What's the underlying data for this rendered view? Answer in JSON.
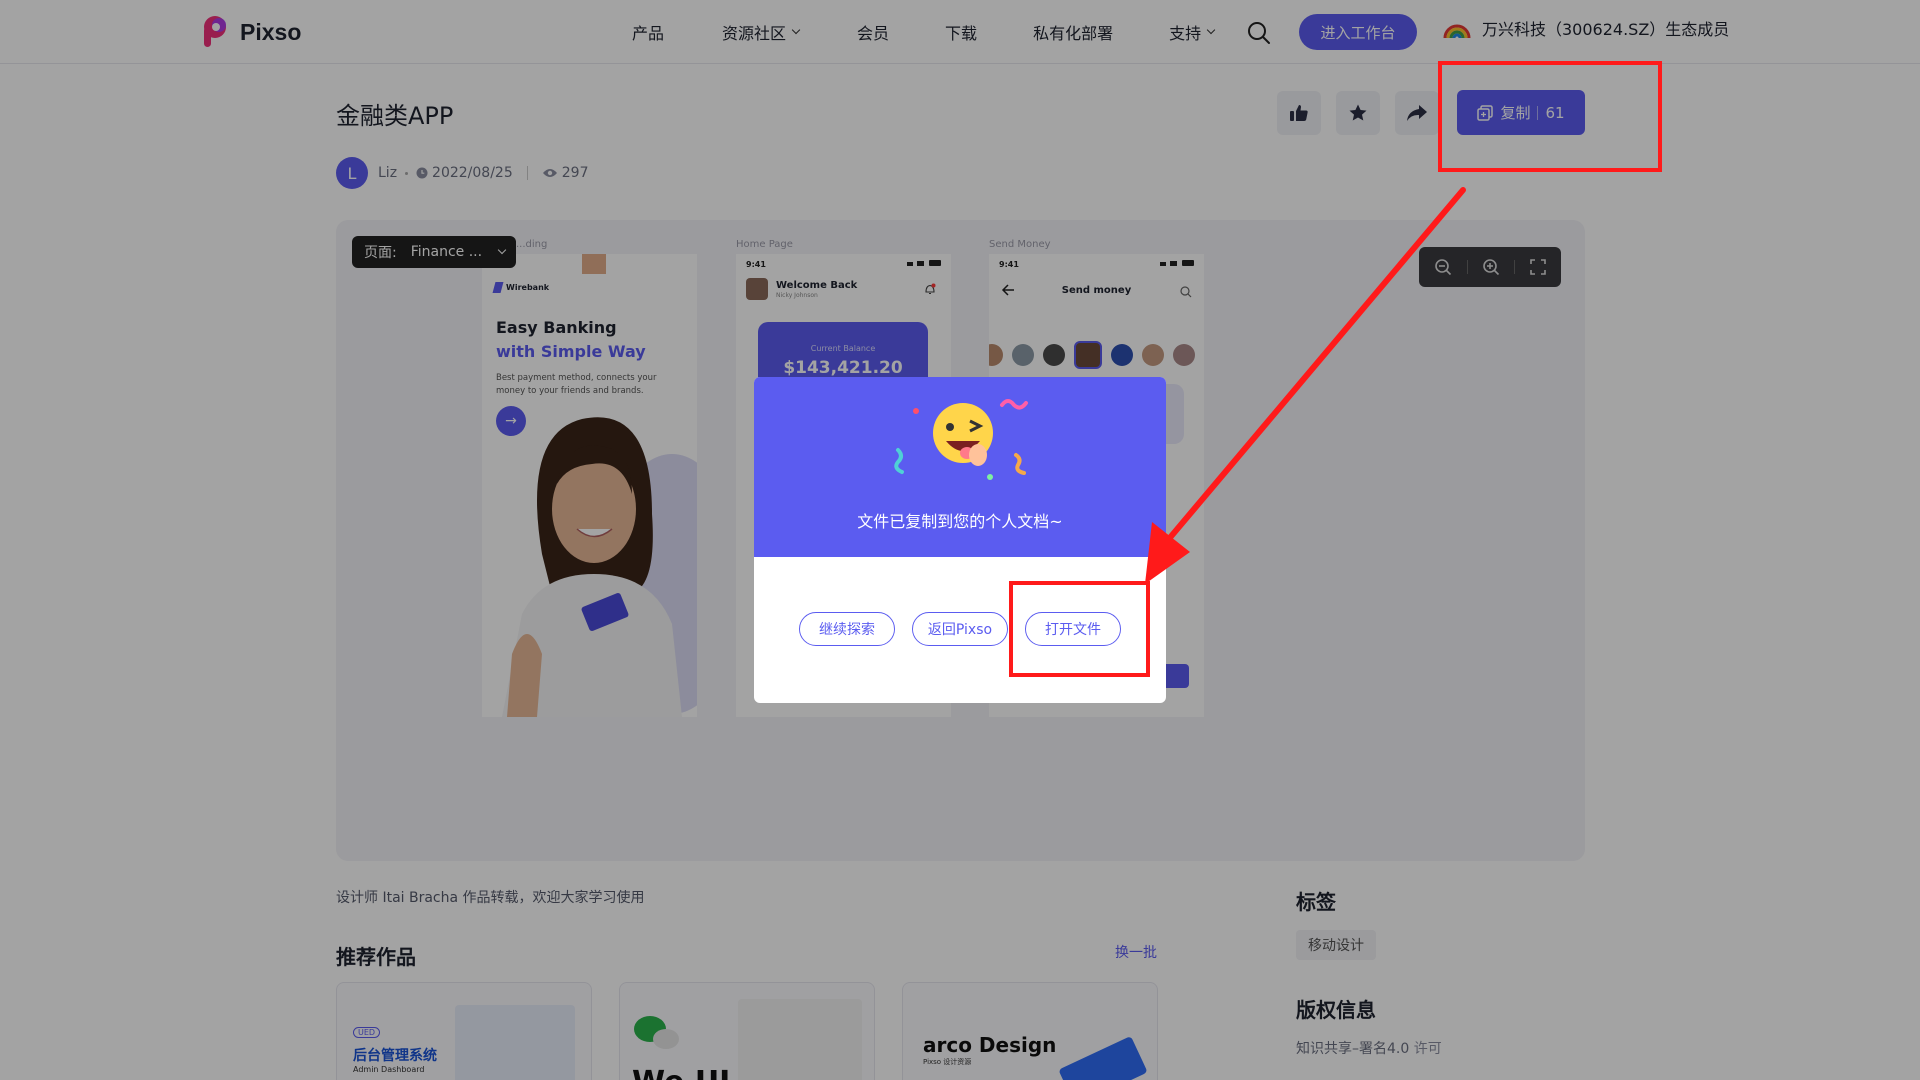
{
  "header": {
    "brand": "Pixso",
    "nav": [
      {
        "label": "产品",
        "has_dropdown": false
      },
      {
        "label": "资源社区",
        "has_dropdown": true
      },
      {
        "label": "会员",
        "has_dropdown": false
      },
      {
        "label": "下载",
        "has_dropdown": false
      },
      {
        "label": "私有化部署",
        "has_dropdown": false
      },
      {
        "label": "支持",
        "has_dropdown": true
      }
    ],
    "workspace_button": "进入工作台",
    "eco_member": "万兴科技（300624.SZ）生态成员"
  },
  "work": {
    "title": "金融类APP",
    "author_initial": "L",
    "author": "Liz",
    "date": "2022/08/25",
    "views": "297",
    "copy_label": "复制",
    "copy_count": "61"
  },
  "preview": {
    "page_select_prefix": "页面:",
    "page_select_value": "Finance ...",
    "frames": [
      {
        "label": "...ding"
      },
      {
        "label": "Home Page"
      },
      {
        "label": "Send Money"
      }
    ],
    "onboarding": {
      "brand": "Wirebank",
      "headline_1": "Easy Banking",
      "headline_2": "with Simple Way",
      "body": "Best payment method, connects your money to your friends and brands.",
      "card_text": "Wirebank"
    },
    "home": {
      "time": "9:41",
      "greeting": "Welcome Back",
      "user": "Nicky Johnson",
      "balance_label": "Current Balance",
      "balance": "$143,421.20"
    },
    "send": {
      "time": "9:41",
      "title": "Send money"
    }
  },
  "modal": {
    "message": "文件已复制到您的个人文档~",
    "buttons": [
      "继续探索",
      "返回Pixso",
      "打开文件"
    ]
  },
  "below": {
    "description": "设计师 Itai Bracha 作品转载，欢迎大家学习使用",
    "recommend_title": "推荐作品",
    "refresh": "换一批",
    "cards": [
      {
        "title": "后台管理系统",
        "subtitle": "Admin Dashboard",
        "badge": "UED"
      },
      {
        "title": "We UI"
      },
      {
        "title": "arco Design",
        "subtitle": "Pixso 设计资源"
      }
    ],
    "tags_title": "标签",
    "tags": [
      "移动设计"
    ],
    "copyright_title": "版权信息",
    "license": "知识共享–署名4.0",
    "license_suffix": "许可"
  },
  "colors": {
    "primary": "#5b5cf0",
    "annotation_red": "#ff1a1a"
  }
}
